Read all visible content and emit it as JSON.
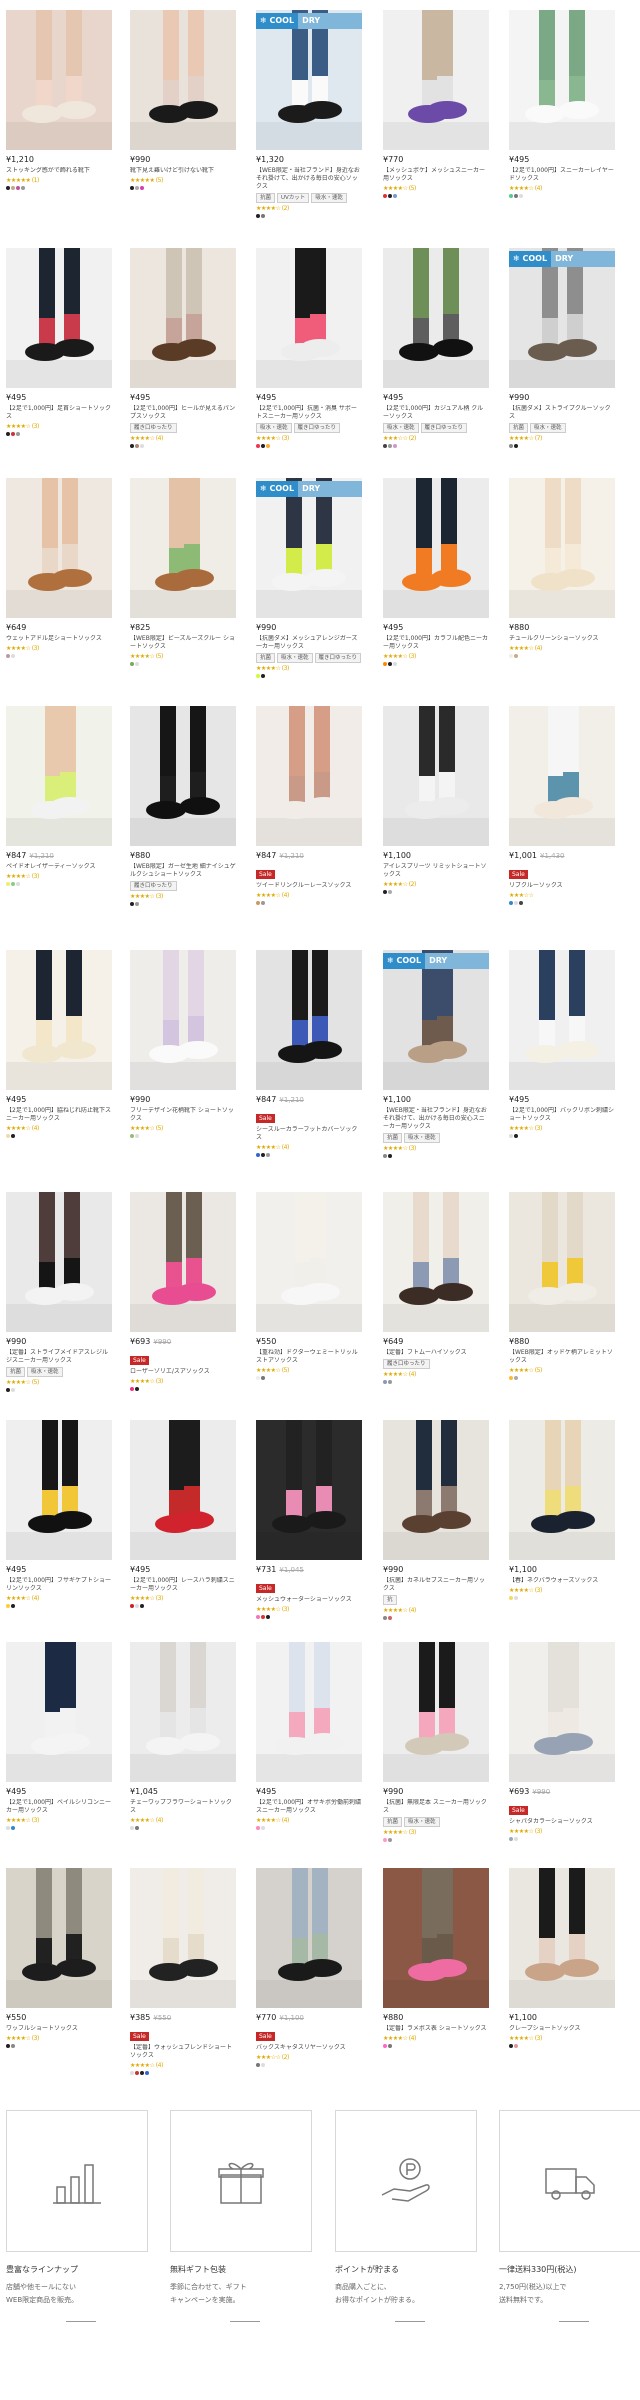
{
  "cool_badge": {
    "left": "❄ COOL",
    "right": "DRY"
  },
  "products": [
    {
      "price": "¥1,210",
      "old": "",
      "sale": "",
      "title": "ストッキング感がで飾れる靴下",
      "tags": [],
      "rating": "★★★★★ (1)",
      "colors": [
        "#222",
        "#c2a88c",
        "#b59",
        "#999"
      ],
      "bg": "#e8d6cc",
      "skin": "#e5c6b0",
      "shoe": "#efe6dc",
      "sock": "#f1d7c9",
      "cool": false
    },
    {
      "price": "¥990",
      "old": "",
      "sale": "",
      "title": "靴下見え難いけど引けない靴下",
      "tags": [],
      "rating": "★★★★★ (5)",
      "colors": [
        "#222",
        "#aaa",
        "#c4a"
      ],
      "bg": "#e9e2da",
      "skin": "#e9c9b4",
      "shoe": "#1a1a1a",
      "sock": "#e3d0c6",
      "cool": false
    },
    {
      "price": "¥1,320",
      "old": "",
      "sale": "",
      "title": "【WEB限定・当社ブランド】身近なおそれ掛けて、出かける毎日の安心ソックス",
      "tags": [
        "抗菌",
        "UVカット",
        "吸水・速乾"
      ],
      "rating": "★★★★☆ (2)",
      "colors": [
        "#222",
        "#777"
      ],
      "bg": "#dfe8ef",
      "skin": "#3b5c85",
      "shoe": "#1b1b1b",
      "sock": "#fafafa",
      "cool": true
    },
    {
      "price": "¥770",
      "old": "",
      "sale": "",
      "title": "【メッシュポケ】メッシュスニーカー用ソックス",
      "tags": [],
      "rating": "★★★★☆ (5)",
      "colors": [
        "#d33",
        "#222",
        "#79c"
      ],
      "bg": "#f0f0f0",
      "skin": "#c9b7a1",
      "shoe": "#6b4aa8",
      "sock": "#e2e2e2",
      "cool": false
    },
    {
      "price": "¥495",
      "old": "",
      "sale": "",
      "title": "【2足で1,000円】スニーカーレイヤードソックス",
      "tags": [],
      "rating": "★★★★☆ (4)",
      "colors": [
        "#5c8",
        "#777",
        "#ddd"
      ],
      "bg": "#f4f4f4",
      "skin": "#7ba885",
      "shoe": "#fafafa",
      "sock": "#89b790",
      "cool": false
    },
    {
      "price": "¥495",
      "old": "",
      "sale": "",
      "title": "【2足で1,000円】足首ショートソックス",
      "tags": [],
      "rating": "★★★★☆ (3)",
      "colors": [
        "#222",
        "#c33",
        "#999"
      ],
      "bg": "#f1f1f1",
      "skin": "#1d2530",
      "shoe": "#1a1a1a",
      "sock": "#c93a4a",
      "cool": false
    },
    {
      "price": "¥495",
      "old": "",
      "sale": "",
      "title": "【2足で1,000円】ヒールが見えるパンプスソックス",
      "tags": [
        "履き口ゆったり"
      ],
      "rating": "★★★★☆ (4)",
      "colors": [
        "#222",
        "#a87",
        "#ddd"
      ],
      "bg": "#ece6df",
      "skin": "#cfc5b6",
      "shoe": "#5a3b26",
      "sock": "#c7a49a",
      "cool": false
    },
    {
      "price": "¥495",
      "old": "",
      "sale": "",
      "title": "【2足で1,000円】抗菌・消臭 サポートスニーカー用ソックス",
      "tags": [
        "吸水・速乾",
        "履き口ゆったり"
      ],
      "rating": "★★★★☆ (3)",
      "colors": [
        "#e35",
        "#222",
        "#fa3"
      ],
      "bg": "#f1f1f1",
      "skin": "#1a1a1a",
      "shoe": "#ededed",
      "sock": "#ef5d7a",
      "cool": false
    },
    {
      "price": "¥495",
      "old": "",
      "sale": "",
      "title": "【2足で1,000円】カジュアル柄 クルーソックス",
      "tags": [
        "吸水・速乾",
        "履き口ゆったり"
      ],
      "rating": "★★★☆☆ (2)",
      "colors": [
        "#444",
        "#999",
        "#c9c"
      ],
      "bg": "#ebebeb",
      "skin": "#6f8f58",
      "shoe": "#111",
      "sock": "#5e5e5e",
      "cool": false
    },
    {
      "price": "¥990",
      "old": "",
      "sale": "",
      "title": "【抗菌ダメ】ストライプクルーソックス",
      "tags": [
        "抗菌",
        "吸水・速乾"
      ],
      "rating": "★★★★☆ (7)",
      "colors": [
        "#888",
        "#222"
      ],
      "bg": "#e5e5e5",
      "skin": "#8e8e8e",
      "shoe": "#6a5d50",
      "sock": "#cfcfcf",
      "cool": true
    },
    {
      "price": "¥649",
      "old": "",
      "sale": "",
      "title": "ウェットアドル足ショートソックス",
      "tags": [],
      "rating": "★★★★☆ (3)",
      "colors": [
        "#b9a",
        "#ddd"
      ],
      "bg": "#efe8e0",
      "skin": "#e6c3a6",
      "shoe": "#b0703d",
      "sock": "#e9d8c8",
      "cool": false
    },
    {
      "price": "¥825",
      "old": "",
      "sale": "",
      "title": "【WEB限定】ビーズルーズクルー ショートソックス",
      "tags": [],
      "rating": "★★★★☆ (5)",
      "colors": [
        "#7a5",
        "#ddd"
      ],
      "bg": "#f0ece6",
      "skin": "#e4c2a8",
      "shoe": "#a96b3b",
      "sock": "#8dbb76",
      "cool": false
    },
    {
      "price": "¥990",
      "old": "",
      "sale": "",
      "title": "【抗菌ダメ】メッシュアレンジガーズ一カー用ソックス",
      "tags": [
        "抗菌",
        "吸水・速乾",
        "履き口ゆったり"
      ],
      "rating": "★★★★☆ (3)",
      "colors": [
        "#cf3",
        "#222"
      ],
      "bg": "#f1f1f1",
      "skin": "#2e3545",
      "shoe": "#f4f4f4",
      "sock": "#d4ec4a",
      "cool": true
    },
    {
      "price": "¥495",
      "old": "",
      "sale": "",
      "title": "【2足で1,000円】カラフル配色ニーカー用ソックス",
      "tags": [],
      "rating": "★★★★☆ (3)",
      "colors": [
        "#f80",
        "#222",
        "#ddd"
      ],
      "bg": "#ececec",
      "skin": "#1c2633",
      "shoe": "#f07b22",
      "sock": "#f07b22",
      "cool": false
    },
    {
      "price": "¥880",
      "old": "",
      "sale": "",
      "title": "チュールクリーンショーソックス",
      "tags": [],
      "rating": "★★★★☆ (4)",
      "colors": [
        "#eee",
        "#ca8"
      ],
      "bg": "#f6f1e8",
      "skin": "#eedcc6",
      "shoe": "#efe2c9",
      "sock": "#f5ead8",
      "cool": false
    },
    {
      "price": "¥847",
      "old": "¥1,210",
      "sale": "",
      "title": "ペイドオレイザーティーソックス",
      "tags": [],
      "rating": "★★★★☆ (3)",
      "colors": [
        "#ee6",
        "#8c8",
        "#ddd"
      ],
      "bg": "#f1f3ea",
      "skin": "#e8c9ad",
      "shoe": "#f2f2f2",
      "sock": "#d9ef7a",
      "cool": false
    },
    {
      "price": "¥880",
      "old": "",
      "sale": "",
      "title": "【WEB限定】ガーゼ生地 細ナイシュゲルクシュショートソックス",
      "tags": [
        "履き口ゆったり"
      ],
      "rating": "★★★★☆ (3)",
      "colors": [
        "#222",
        "#999"
      ],
      "bg": "#e6e6e6",
      "skin": "#161616",
      "shoe": "#101010",
      "sock": "#1e1e1e",
      "cool": false
    },
    {
      "price": "¥847",
      "old": "¥1,210",
      "sale": "Sale",
      "title": "ツイードリンクルーレースソックス",
      "tags": [],
      "rating": "★★★★☆ (4)",
      "colors": [
        "#c96",
        "#999"
      ],
      "bg": "#f1ece7",
      "skin": "#d69e86",
      "shoe": "#f1ece7",
      "sock": "#c99a87",
      "cool": false
    },
    {
      "price": "¥1,100",
      "old": "",
      "sale": "",
      "title": "アイレスプリーツ リミットショートソックス",
      "tags": [],
      "rating": "★★★★☆ (2)",
      "colors": [
        "#222",
        "#aaa"
      ],
      "bg": "#e9e9e9",
      "skin": "#2a2a2a",
      "shoe": "#ececec",
      "sock": "#f4f4f4",
      "cool": false
    },
    {
      "price": "¥1,001",
      "old": "¥1,430",
      "sale": "Sale",
      "title": "リブクルーソックス",
      "tags": [],
      "rating": "★★★☆☆",
      "colors": [
        "#38c",
        "#ddd",
        "#444"
      ],
      "bg": "#f2efe8",
      "skin": "#f6f6f6",
      "shoe": "#f1e7da",
      "sock": "#5c93ad",
      "cool": false
    },
    {
      "price": "¥495",
      "old": "",
      "sale": "",
      "title": "【2足で1,000円】脇ねじれ防止靴下スニーカー用ソックス",
      "tags": [],
      "rating": "★★★★☆ (4)",
      "colors": [
        "#eda",
        "#222"
      ],
      "bg": "#f5f1e8",
      "skin": "#1e2532",
      "shoe": "#f1e7cf",
      "sock": "#f3e6c9",
      "cool": false
    },
    {
      "price": "¥990",
      "old": "",
      "sale": "",
      "title": "フリーデザイン花柄靴下 ショートソックス",
      "tags": [],
      "rating": "★★★★☆ (5)",
      "colors": [
        "#9b7",
        "#ddd"
      ],
      "bg": "#efedea",
      "skin": "#e3d6e4",
      "shoe": "#fafafa",
      "sock": "#d3c5e0",
      "cool": false
    },
    {
      "price": "¥847",
      "old": "¥1,210",
      "sale": "Sale",
      "title": "シースルーカラーフットカバーソックス",
      "tags": [],
      "rating": "★★★★☆ (4)",
      "colors": [
        "#36c",
        "#222",
        "#999"
      ],
      "bg": "#e3e3e3",
      "skin": "#1b1b1b",
      "shoe": "#151515",
      "sock": "#3c59b7",
      "cool": false
    },
    {
      "price": "¥1,100",
      "old": "",
      "sale": "",
      "title": "【WEB限定・当社ブランド】身近なおそれ掛けて、出かける毎日の安心スニーカー用ソックス",
      "tags": [
        "抗菌",
        "吸水・速乾"
      ],
      "rating": "★★★★☆ (3)",
      "colors": [
        "#888",
        "#222"
      ],
      "bg": "#e2e2e2",
      "skin": "#3c4c6b",
      "shoe": "#b99f86",
      "sock": "#6f5b4e",
      "cool": true
    },
    {
      "price": "¥495",
      "old": "",
      "sale": "",
      "title": "【2足で1,000円】バックリボン刺繍ショートソックス",
      "tags": [],
      "rating": "★★★★☆ (3)",
      "colors": [
        "#ddd",
        "#222"
      ],
      "bg": "#f0f0f0",
      "skin": "#2b3f5e",
      "shoe": "#f5f0e4",
      "sock": "#f7f7f7",
      "cool": false
    },
    {
      "price": "¥990",
      "old": "",
      "sale": "",
      "title": "【定番】ストライプメイドアスレジルジスニーカー用ソックス",
      "tags": [
        "抗菌",
        "吸水・速乾"
      ],
      "rating": "★★★★☆ (5)",
      "colors": [
        "#222",
        "#ddd"
      ],
      "bg": "#e9e9e9",
      "skin": "#4e3d3a",
      "shoe": "#f3f3f3",
      "sock": "#151515",
      "cool": false
    },
    {
      "price": "¥693",
      "old": "¥990",
      "sale": "Sale",
      "title": "ローザーゾリエ/スアソックス",
      "tags": [],
      "rating": "★★★★☆ (3)",
      "colors": [
        "#e38",
        "#222"
      ],
      "bg": "#ebe8e3",
      "skin": "#6b5f52",
      "shoe": "#e84c91",
      "sock": "#e8538f",
      "cool": false
    },
    {
      "price": "¥550",
      "old": "",
      "sale": "",
      "title": "【重ね効】ドクターウェミートリッルストアソックス",
      "tags": [],
      "rating": "★★★★☆ (5)",
      "colors": [
        "#eee",
        "#777"
      ],
      "bg": "#f2f0ec",
      "skin": "#f4f1ea",
      "shoe": "#f7f7f7",
      "sock": "#f1efe9",
      "cool": false
    },
    {
      "price": "¥649",
      "old": "",
      "sale": "",
      "title": "【定番】フトムーハイソックス",
      "tags": [
        "履き口ゆったり"
      ],
      "rating": "★★★★☆ (4)",
      "colors": [
        "#89b",
        "#999"
      ],
      "bg": "#f1efe9",
      "skin": "#e8dacc",
      "shoe": "#3b2d26",
      "sock": "#8c9ab3",
      "cool": false
    },
    {
      "price": "¥880",
      "old": "",
      "sale": "",
      "title": "【WEB限定】オッドケ柄アレミットソックス",
      "tags": [],
      "rating": "★★★★☆ (5)",
      "colors": [
        "#fb3",
        "#aaa"
      ],
      "bg": "#ebe7de",
      "skin": "#e3d9c9",
      "shoe": "#f0ede6",
      "sock": "#f0c93a",
      "cool": false
    },
    {
      "price": "¥495",
      "old": "",
      "sale": "",
      "title": "【2足で1,000円】フサギケプトショーリンソックス",
      "tags": [],
      "rating": "★★★★☆ (4)",
      "colors": [
        "#fc3",
        "#222"
      ],
      "bg": "#efefef",
      "skin": "#171717",
      "shoe": "#111",
      "sock": "#f2c737",
      "cool": false
    },
    {
      "price": "¥495",
      "old": "",
      "sale": "",
      "title": "【2足で1,000円】レースハラ刺繍スニーカー用ソックス",
      "tags": [],
      "rating": "★★★★☆ (3)",
      "colors": [
        "#c22",
        "#ddd",
        "#222"
      ],
      "bg": "#ececec",
      "skin": "#1c1c1c",
      "shoe": "#d0232e",
      "sock": "#c42a2a",
      "cool": false
    },
    {
      "price": "¥731",
      "old": "¥1,045",
      "sale": "Sale",
      "title": "メッシュウォーターショーソックス",
      "tags": [],
      "rating": "★★★★☆ (3)",
      "colors": [
        "#e7b",
        "#d33",
        "#222"
      ],
      "bg": "#2b2b2b",
      "skin": "#222",
      "shoe": "#1a1a1a",
      "sock": "#e98cb3",
      "cool": false
    },
    {
      "price": "¥990",
      "old": "",
      "sale": "",
      "title": "【抗菌】カネルセブスニーカー用ソックス",
      "tags": [
        "抗"
      ],
      "rating": "★★★★☆ (4)",
      "colors": [
        "#888",
        "#c66"
      ],
      "bg": "#e7e3dd",
      "skin": "#212c3d",
      "shoe": "#5a4030",
      "sock": "#8c7a70",
      "cool": false
    },
    {
      "price": "¥1,100",
      "old": "",
      "sale": "",
      "title": "【春】ネクバラウォーズソックス",
      "tags": [],
      "rating": "★★★★☆ (3)",
      "colors": [
        "#ed6",
        "#ddd"
      ],
      "bg": "#ecebe6",
      "skin": "#e8d4b6",
      "shoe": "#1a2230",
      "sock": "#efdc7a",
      "cool": false
    },
    {
      "price": "¥495",
      "old": "",
      "sale": "",
      "title": "【2足で1,000円】ベイルシリコンニーカー用ソックス",
      "tags": [],
      "rating": "★★★★☆ (3)",
      "colors": [
        "#ddd",
        "#38c"
      ],
      "bg": "#f0f0f0",
      "skin": "#1c2a44",
      "shoe": "#f4f4f4",
      "sock": "#f2f2f2",
      "cool": false
    },
    {
      "price": "¥1,045",
      "old": "",
      "sale": "",
      "title": "チェーワップフラワーショートソックス",
      "tags": [],
      "rating": "★★★★☆ (4)",
      "colors": [
        "#ddd",
        "#777"
      ],
      "bg": "#ececec",
      "skin": "#dad7d2",
      "shoe": "#f4f4f4",
      "sock": "#e5e5e5",
      "cool": false
    },
    {
      "price": "¥495",
      "old": "",
      "sale": "",
      "title": "【2足で1,000円】オサキボ労働前刺繍スニーカー用ソックス",
      "tags": [],
      "rating": "★★★★☆ (4)",
      "colors": [
        "#f8b",
        "#ddd"
      ],
      "bg": "#f2f2f2",
      "skin": "#dde3ec",
      "shoe": "#f1f1f1",
      "sock": "#f5a9bf",
      "cool": false
    },
    {
      "price": "¥990",
      "old": "",
      "sale": "",
      "title": "【抗菌】無限足本 スニーカー用ソックス",
      "tags": [
        "抗菌",
        "吸水・速乾"
      ],
      "rating": "★★★★☆ (3)",
      "colors": [
        "#f9c",
        "#999"
      ],
      "bg": "#ededed",
      "skin": "#1b1b1b",
      "shoe": "#d2c9b9",
      "sock": "#f4a7bd",
      "cool": false
    },
    {
      "price": "¥693",
      "old": "¥990",
      "sale": "Sale",
      "title": "シャパタカラーショーソックス",
      "tags": [],
      "rating": "★★★★☆ (3)",
      "colors": [
        "#9ab",
        "#ddd"
      ],
      "bg": "#f0efec",
      "skin": "#e4e0da",
      "shoe": "#97a3b5",
      "sock": "#eeeae3",
      "cool": false
    },
    {
      "price": "¥550",
      "old": "",
      "sale": "",
      "title": "ワッフルショートソックス",
      "tags": [],
      "rating": "★★★★☆ (3)",
      "colors": [
        "#222",
        "#888"
      ],
      "bg": "#d8d4c9",
      "skin": "#8e8b7e",
      "shoe": "#1d1d1d",
      "sock": "#212121",
      "cool": false
    },
    {
      "price": "¥385",
      "old": "¥550",
      "sale": "Sale",
      "title": "【定番】ウォッシュブレンドショートソックス",
      "tags": [],
      "rating": "★★★★☆ (4)",
      "colors": [
        "#ddd",
        "#c33",
        "#222",
        "#36c"
      ],
      "bg": "#f0ede8",
      "skin": "#f2ece0",
      "shoe": "#222",
      "sock": "#e6dccb",
      "cool": false
    },
    {
      "price": "¥770",
      "old": "¥1,100",
      "sale": "Sale",
      "title": "バックスキャタスリヤーソックス",
      "tags": [],
      "rating": "★★★☆☆ (2)",
      "colors": [
        "#777",
        "#ddd"
      ],
      "bg": "#d5d2cd",
      "skin": "#a3b3c2",
      "shoe": "#1a1a1a",
      "sock": "#a6b9a6",
      "cool": false
    },
    {
      "price": "¥880",
      "old": "",
      "sale": "",
      "title": "【定番】ラメボス表 ショートソックス",
      "tags": [],
      "rating": "★★★★☆ (4)",
      "colors": [
        "#f6c",
        "#777"
      ],
      "bg": "#8a5844",
      "skin": "#7a6c5d",
      "shoe": "#ef6ca2",
      "sock": "#6a5a4a",
      "cool": false
    },
    {
      "price": "¥1,100",
      "old": "",
      "sale": "",
      "title": "クレープショートソックス",
      "tags": [],
      "rating": "★★★★☆ (3)",
      "colors": [
        "#222",
        "#d99"
      ],
      "bg": "#eae6e0",
      "skin": "#1b1b1b",
      "shoe": "#c9a489",
      "sock": "#e5d2c5",
      "cool": false
    }
  ],
  "features": [
    {
      "icon": "chart-bars-icon",
      "title": "豊富なラインナップ",
      "desc": "店舗や他モールにない\nWEB限定商品を販売。"
    },
    {
      "icon": "gift-box-icon",
      "title": "無料ギフト包装",
      "desc": "季節に合わせて、ギフト\nキャンペーンを実施。"
    },
    {
      "icon": "points-hand-icon",
      "title": "ポイントが貯まる",
      "desc": "商品購入ごとに、\nお得なポイントが貯まる。"
    },
    {
      "icon": "delivery-truck-icon",
      "title": "一律送料330円(税込)",
      "desc": "2,750円(税込)以上で\n送料無料です。"
    }
  ]
}
